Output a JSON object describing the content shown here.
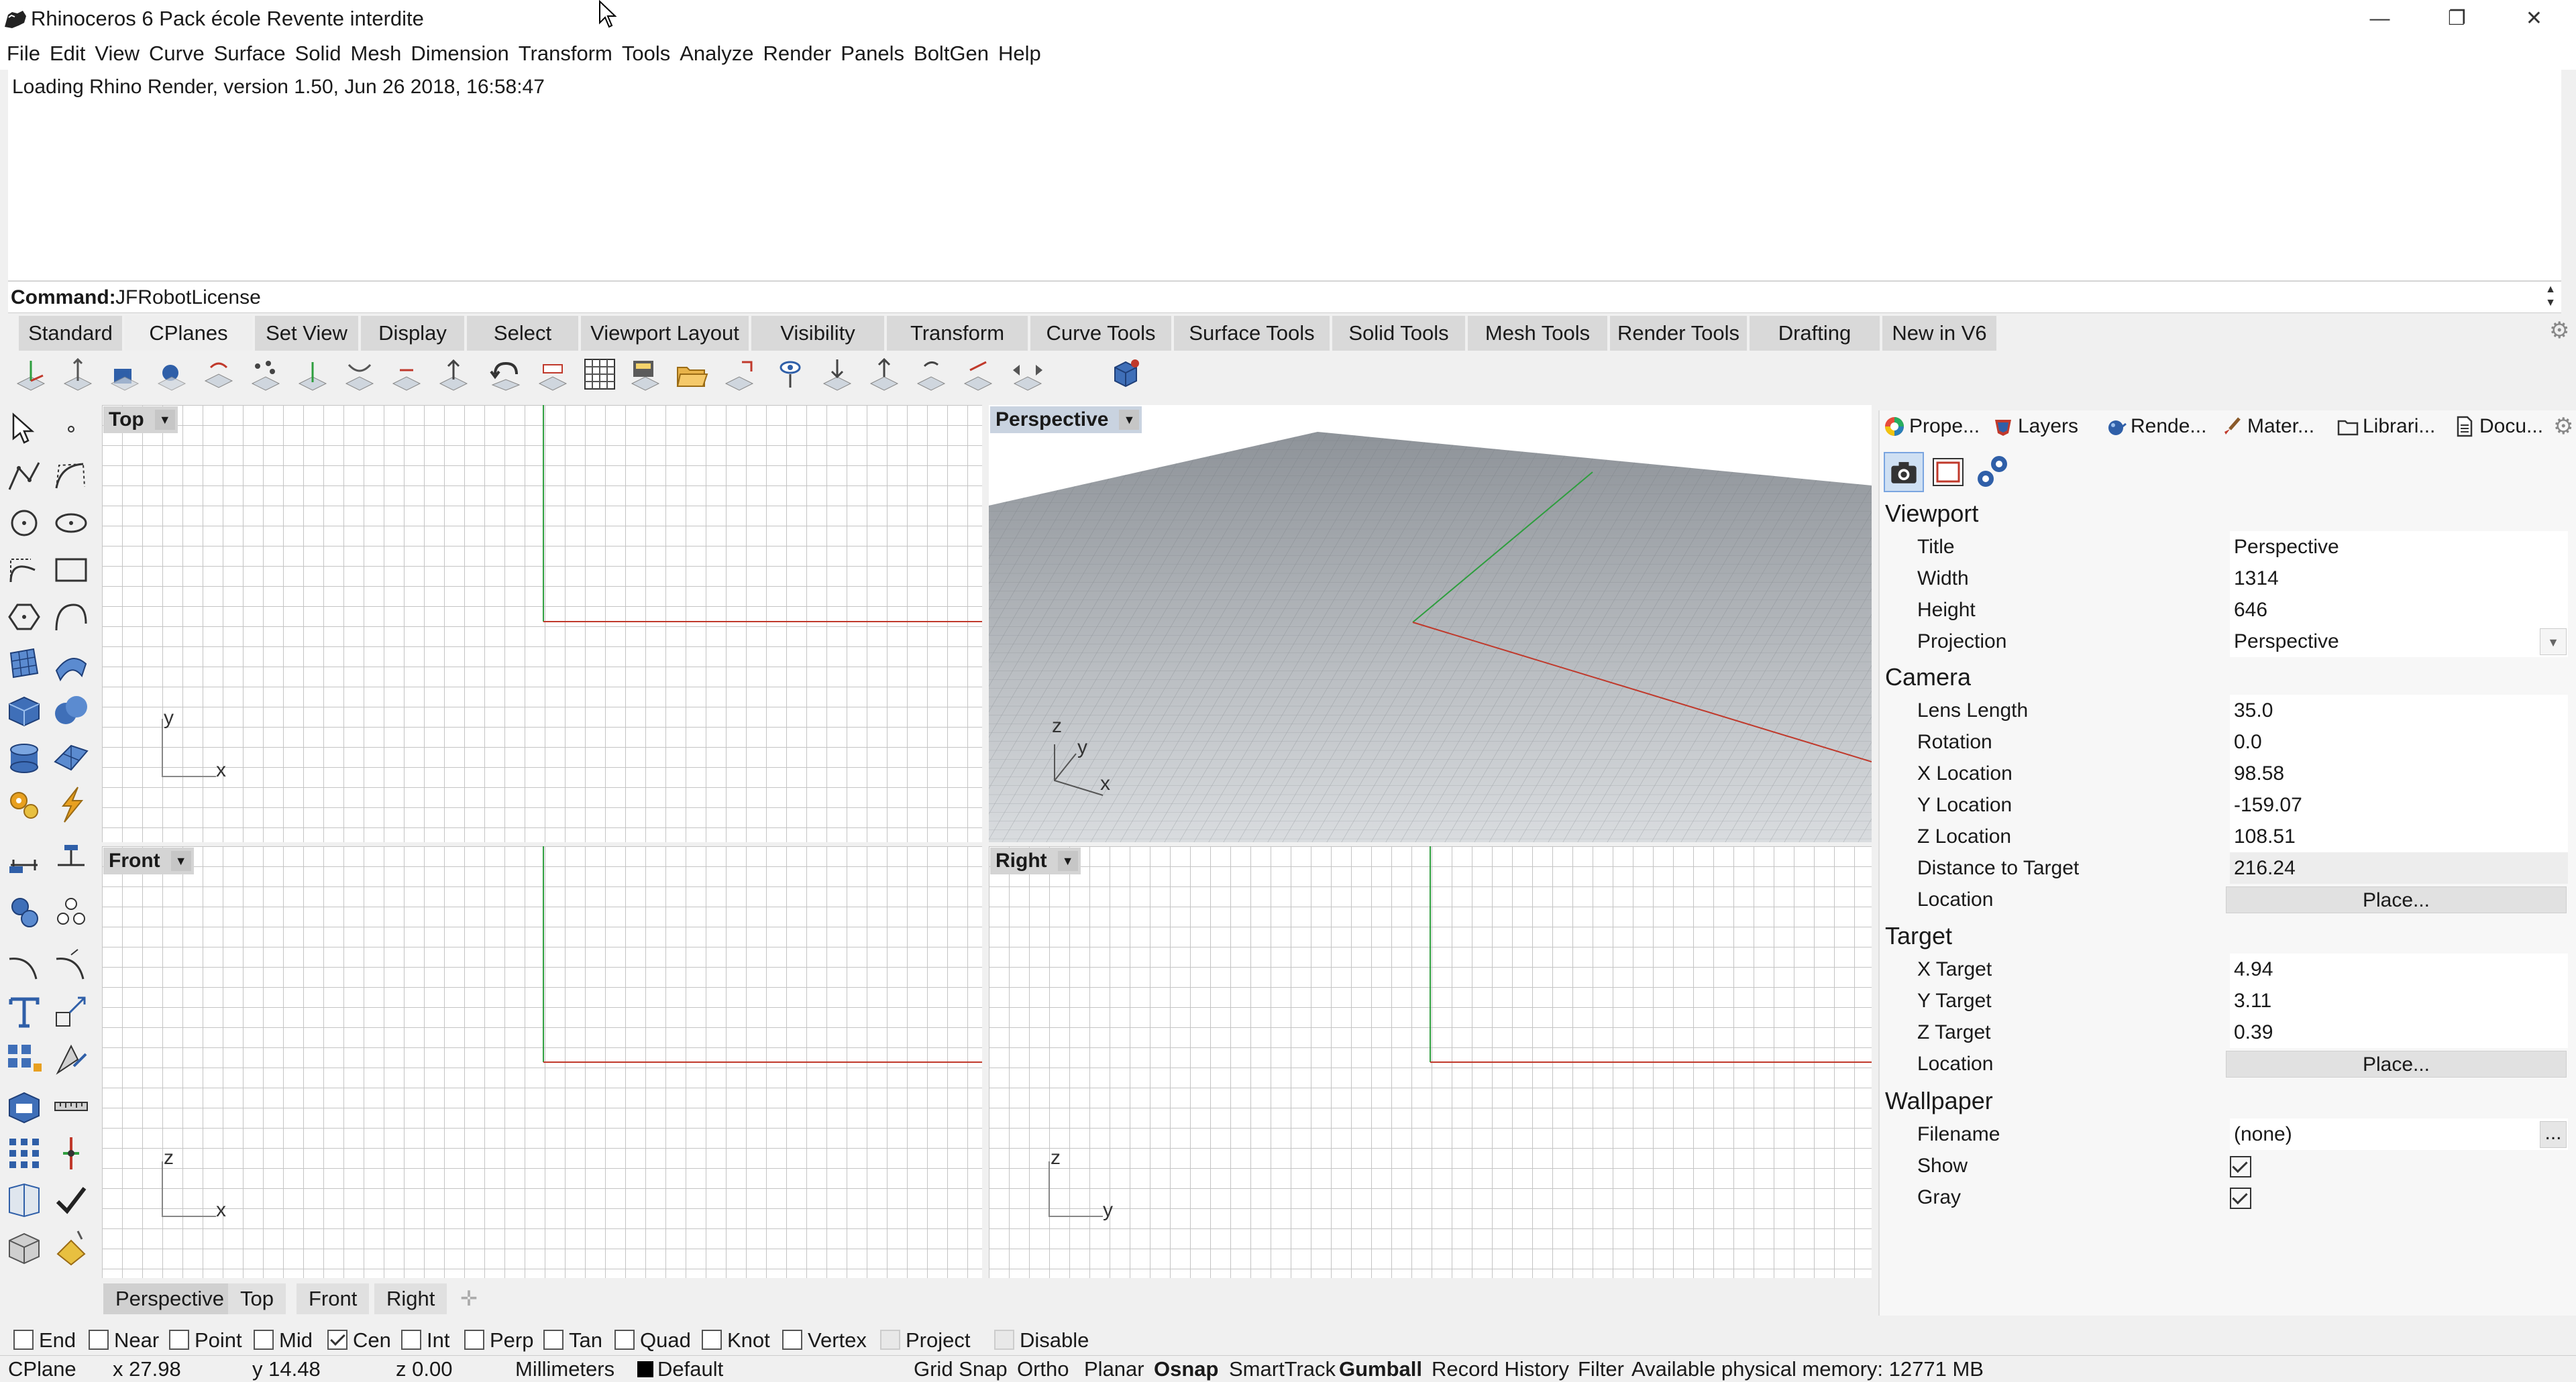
{
  "window": {
    "title": "Rhinoceros 6 Pack école Revente interdite",
    "minimize": "—",
    "maximize": "❐",
    "close": "✕"
  },
  "menu": [
    "File",
    "Edit",
    "View",
    "Curve",
    "Surface",
    "Solid",
    "Mesh",
    "Dimension",
    "Transform",
    "Tools",
    "Analyze",
    "Render",
    "Panels",
    "BoltGen",
    "Help"
  ],
  "history": {
    "line": "Loading Rhino Render, version 1.50, Jun 26 2018, 16:58:47"
  },
  "command": {
    "label": "Command:",
    "value": "JFRobotLicense"
  },
  "toolbar_tabs": [
    "Standard",
    "CPlanes",
    "Set View",
    "Display",
    "Select",
    "Viewport Layout",
    "Visibility",
    "Transform",
    "Curve Tools",
    "Surface Tools",
    "Solid Tools",
    "Mesh Tools",
    "Render Tools",
    "Drafting",
    "New in V6"
  ],
  "active_toolbar_tab": "CPlanes",
  "viewports": {
    "top": {
      "label": "Top",
      "axis1": "y",
      "axis2": "x"
    },
    "perspective": {
      "label": "Perspective",
      "axis1": "z",
      "axis2": "y",
      "axis3": "x"
    },
    "front": {
      "label": "Front",
      "axis1": "z",
      "axis2": "x"
    },
    "right": {
      "label": "Right",
      "axis1": "z",
      "axis2": "y"
    }
  },
  "viewport_tabs": [
    "Perspective",
    "Top",
    "Front",
    "Right"
  ],
  "viewport_tab_add": "✛",
  "panel": {
    "tabs": [
      "Prope...",
      "Layers",
      "Rende...",
      "Mater...",
      "Librari...",
      "Docu..."
    ],
    "viewport": {
      "heading": "Viewport",
      "rows": [
        [
          "Title",
          "Perspective"
        ],
        [
          "Width",
          "1314"
        ],
        [
          "Height",
          "646"
        ],
        [
          "Projection",
          "Perspective"
        ]
      ]
    },
    "camera": {
      "heading": "Camera",
      "rows": [
        [
          "Lens Length",
          "35.0"
        ],
        [
          "Rotation",
          "0.0"
        ],
        [
          "X Location",
          "98.58"
        ],
        [
          "Y Location",
          "-159.07"
        ],
        [
          "Z Location",
          "108.51"
        ],
        [
          "Distance to Target",
          "216.24"
        ]
      ],
      "location_label": "Location",
      "location_button": "Place..."
    },
    "target": {
      "heading": "Target",
      "rows": [
        [
          "X Target",
          "4.94"
        ],
        [
          "Y Target",
          "3.11"
        ],
        [
          "Z Target",
          "0.39"
        ]
      ],
      "location_label": "Location",
      "location_button": "Place..."
    },
    "wallpaper": {
      "heading": "Wallpaper",
      "filename_label": "Filename",
      "filename_value": "(none)",
      "browse": "...",
      "show_label": "Show",
      "show_checked": true,
      "gray_label": "Gray",
      "gray_checked": true
    }
  },
  "osnap": [
    {
      "label": "End",
      "checked": false
    },
    {
      "label": "Near",
      "checked": false
    },
    {
      "label": "Point",
      "checked": false
    },
    {
      "label": "Mid",
      "checked": false
    },
    {
      "label": "Cen",
      "checked": true
    },
    {
      "label": "Int",
      "checked": false
    },
    {
      "label": "Perp",
      "checked": false
    },
    {
      "label": "Tan",
      "checked": false
    },
    {
      "label": "Quad",
      "checked": false
    },
    {
      "label": "Knot",
      "checked": false
    },
    {
      "label": "Vertex",
      "checked": false
    },
    {
      "label": "Project",
      "checked": false,
      "disabled": true
    },
    {
      "label": "Disable",
      "checked": false,
      "disabled": true
    }
  ],
  "status": {
    "cplane": "CPlane",
    "x": "x 27.98",
    "y": "y 14.48",
    "z": "z 0.00",
    "units": "Millimeters",
    "layer": "Default",
    "grid_snap": "Grid Snap",
    "ortho": "Ortho",
    "planar": "Planar",
    "osnap": "Osnap",
    "smarttrack": "SmartTrack",
    "gumball": "Gumball",
    "record_history": "Record History",
    "filter": "Filter",
    "memory": "Available physical memory: 12771 MB"
  },
  "colors": {
    "x_axis": "#c0392b",
    "y_axis": "#2e9e3e",
    "grid": "#c4c4c4",
    "layer_swatch": "#000000"
  }
}
